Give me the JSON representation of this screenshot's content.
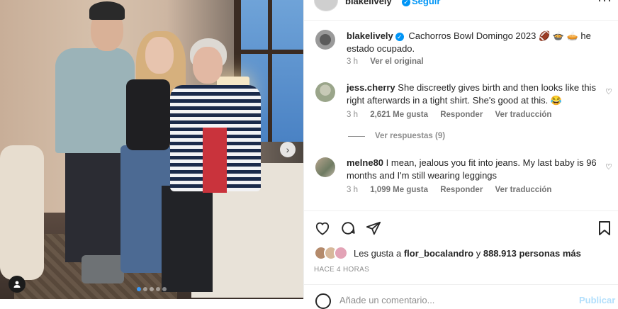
{
  "post": {
    "username": "blakelively",
    "follow_label": "Seguir",
    "more_label": "···"
  },
  "caption": {
    "username": "blakelively",
    "text": "Cachorros Bowl Domingo 2023 🏈 🍲 🥧 he estado ocupado.",
    "time": "3 h",
    "see_original": "Ver el original"
  },
  "comments": [
    {
      "username": "jess.cherry",
      "text": "She discreetly gives birth and then looks like this right afterwards in a tight shirt. She's good at this. 😂",
      "time": "3 h",
      "likes": "2,621 Me gusta",
      "reply": "Responder",
      "translate": "Ver traducción",
      "view_replies": "Ver respuestas (9)"
    },
    {
      "username": "melne80",
      "text": "I mean, jealous you fit into jeans. My last baby is 96 months and I'm still wearing leggings",
      "time": "3 h",
      "likes": "1,099 Me gusta",
      "reply": "Responder",
      "translate": "Ver traducción"
    }
  ],
  "likes": {
    "prefix": "Les gusta a",
    "user": "flor_bocalandro",
    "joiner": "y",
    "others": "888.913 personas más"
  },
  "timestamp": "HACE 4 HORAS",
  "add_comment_placeholder": "Añade un comentario...",
  "publish_label": "Publicar",
  "colors": {
    "accent": "#0095f6",
    "muted": "#8e8e8e",
    "text": "#262626"
  },
  "icons": [
    "heart-icon",
    "comment-icon",
    "share-icon",
    "save-icon",
    "next-arrow-icon",
    "user-tag-icon",
    "verified-icon"
  ]
}
